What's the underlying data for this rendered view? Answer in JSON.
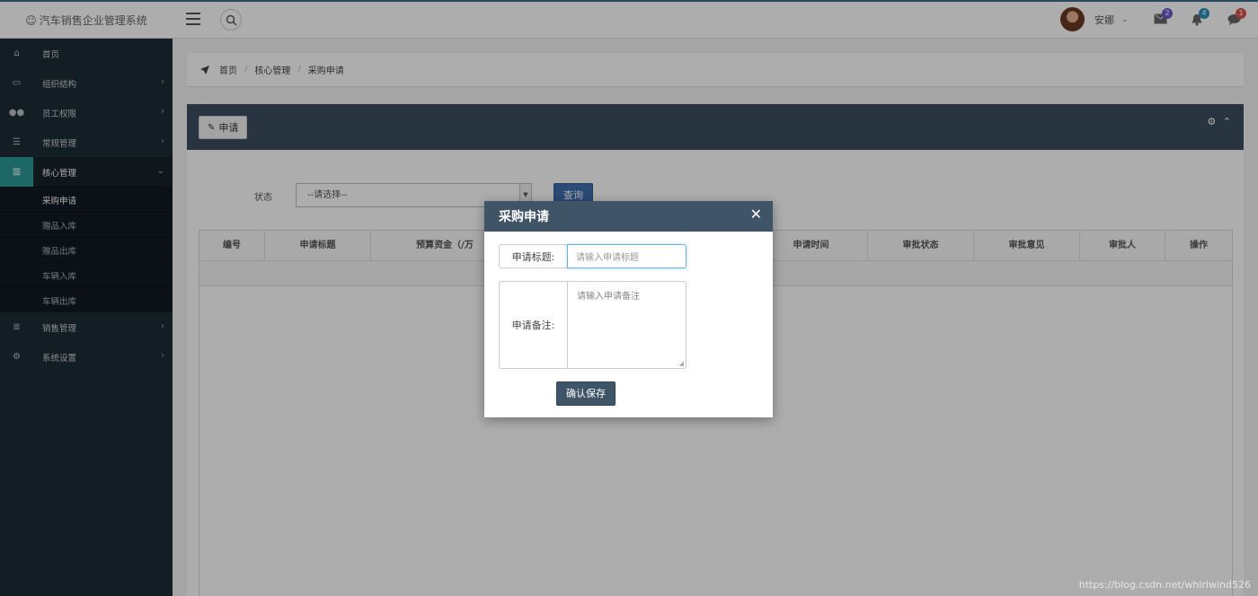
{
  "app": {
    "title": "汽车销售企业管理系统",
    "logo_glyph": "☺"
  },
  "topbar": {
    "user_name": "安娜",
    "mail_badge": "2",
    "bell_badge": "4",
    "chat_badge": "1",
    "colors": {
      "mail_badge": "#6a5acd",
      "bell_badge": "#2a8fbd",
      "chat_badge": "#d9534f"
    }
  },
  "sidebar": {
    "items": [
      {
        "label": "首页",
        "icon": "home-icon"
      },
      {
        "label": "组织结构",
        "icon": "monitor-icon"
      },
      {
        "label": "员工权限",
        "icon": "users-icon"
      },
      {
        "label": "常规管理",
        "icon": "list-icon"
      },
      {
        "label": "核心管理",
        "icon": "chart-icon"
      },
      {
        "label": "销售管理",
        "icon": "list-bullets-icon"
      },
      {
        "label": "系统设置",
        "icon": "gears-icon"
      }
    ],
    "sub_items": [
      "采购申请",
      "赠品入库",
      "赠品出库",
      "车辆入库",
      "车辆出库"
    ]
  },
  "breadcrumb": {
    "home": "首页",
    "section": "核心管理",
    "current": "采购申请"
  },
  "panel": {
    "apply_label": "申请",
    "filter_label": "状态",
    "filter_value": "--请选择--",
    "query_label": "查询",
    "columns": [
      "编号",
      "申请标题",
      "预算资金（/万",
      "",
      "申请时间",
      "审批状态",
      "审批意见",
      "审批人",
      "操作"
    ]
  },
  "modal": {
    "title": "采购申请",
    "close": "✕",
    "title_label": "申请标题:",
    "title_placeholder": "请输入申请标题",
    "note_label": "申请备注:",
    "note_placeholder": "请输入申请备注",
    "save_label": "确认保存"
  },
  "watermark": "https://blog.csdn.net/whirlwind526"
}
